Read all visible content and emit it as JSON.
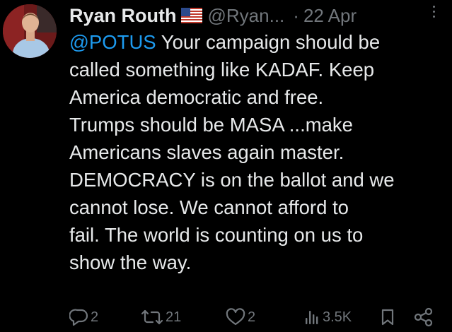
{
  "author": {
    "display_name": "Ryan Routh",
    "flag_icon": "us-flag-icon",
    "handle": "@Ryan...",
    "separator": "·",
    "timestamp": "22 Apr",
    "avatar_icon": "profile-avatar"
  },
  "tweet": {
    "mention": "@POTUS",
    "first_line_rest": " Your campaign should be",
    "lines": [
      "called something like KADAF. Keep",
      "America democratic and free.",
      "Trumps should be MASA ...make",
      "Americans slaves again master.",
      "DEMOCRACY is on the ballot and we",
      "cannot lose. We cannot afford to",
      "fail. The world is counting on us to",
      "show the way."
    ]
  },
  "actions": {
    "replies": "2",
    "reposts": "21",
    "likes": "2",
    "views": "3.5K"
  },
  "colors": {
    "background": "#000000",
    "text": "#e7e9ea",
    "muted": "#71767b",
    "link": "#1d9bf0"
  }
}
